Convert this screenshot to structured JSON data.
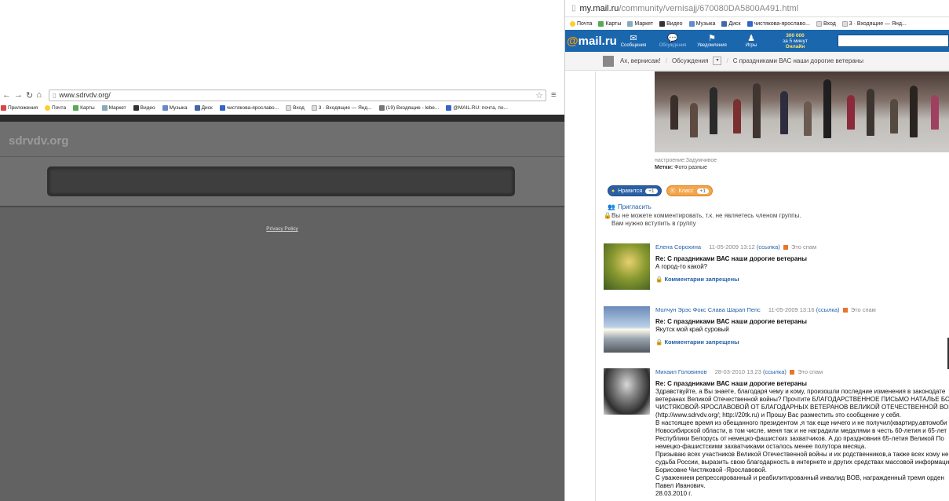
{
  "left": {
    "url": "www.sdrvdv.org/",
    "bookmarks": [
      "Приложения",
      "Почта",
      "Карты",
      "Маркет",
      "Видео",
      "Музыка",
      "Диск",
      "чистякова-ярославо...",
      "Вход",
      "3 · Входящие — Янд...",
      "(19) Входящие - lebe...",
      "@MAIL.RU: почта, по..."
    ],
    "site_name": "sdrvdv.org",
    "privacy_link": "Privacy Policy"
  },
  "right": {
    "url_domain": "my.mail.ru",
    "url_path": "/community/vernisajj/670080DA5800A491.html",
    "bookmarks": [
      "Почта",
      "Карты",
      "Маркет",
      "Видео",
      "Музыка",
      "Диск",
      "чистякова-ярославо...",
      "Вход",
      "3 · Входящие — Янд..."
    ],
    "header": {
      "logo_prefix": "@",
      "logo": "mail",
      "logo_suffix": ".ru",
      "items": [
        {
          "badge": "10",
          "label": "Сообщения"
        },
        {
          "badge": "",
          "label": "Обсуждения"
        },
        {
          "badge": "1",
          "label": "Уведомления"
        },
        {
          "badge": "1",
          "label": "Игры"
        }
      ],
      "promo_amount": "300 000",
      "promo_sub": "за 5 минут",
      "promo_online": "Онлайн"
    },
    "breadcrumbs": [
      "Ах, вернисаж!",
      "Обсуждения",
      "С праздниками ВАС наши дорогие ветераны"
    ],
    "post": {
      "mood_label": "настроение:",
      "mood": "Задумчивое",
      "tags_label": "Метки:",
      "tags": "Фото разные",
      "like_label": "Нравится",
      "like_count": "+1",
      "class_label": "Класс",
      "class_count": "+1",
      "invite": "Пригласить",
      "no_comment_1": "Вы не можете комментировать, т.к. не являетесь членом группы.",
      "no_comment_2": "Вам нужно вступить в группу"
    },
    "comments": [
      {
        "author": "Елена Сорохина",
        "date": "11-05-2009 13:12",
        "link": "(ссылка)",
        "spam": "Это спам",
        "title": "Re: С праздниками ВАС наши дорогие ветераны",
        "lines": [
          "А город-то какой?"
        ],
        "closed": "Комментарии запрещены"
      },
      {
        "author": "Молчун Эрэс Фокс Слава Шарап Пепс",
        "date": "11-05-2009 13:16",
        "link": "(ссылка)",
        "spam": "Это спам",
        "title": "Re: С праздниками ВАС наши дорогие ветераны",
        "lines": [
          "Якутск мой край суровый"
        ],
        "closed": "Комментарии запрещены"
      },
      {
        "author": "Михаил Головинов",
        "date": "28-03-2010 13:23",
        "link": "(ссылка)",
        "spam": "Это спам",
        "title": "Re: С праздниками ВАС наши дорогие ветераны",
        "lines": [
          "Здравствуйте, а Вы знаете, благодаря чему и кому, произошли последние изменения в законодате",
          "ветеранах Великой Отечественной войны? Прочтите БЛАГОДАРСТВЕННОЕ ПИСЬМО НАТАЛЬЕ БС",
          "ЧИСТЯКОВОЙ-ЯРОСЛАВОВОЙ ОТ БЛАГОДАРНЫХ ВЕТЕРАНОВ ВЕЛИКОЙ ОТЕЧЕСТВЕННОЙ ВОЙ",
          "(http://www.sdrvdv.org/; http://20tk.ru) и Прошу Вас разместить это сообщение у себя.",
          "В настоящее время из обещанного президентом ,я так еще ничего и не получил(квартиру,автомоби",
          "Новосибирской области, в том числе, меня так и не наградили медалями в честь 60-летия и 65-лет",
          "Республики Белорусь от немецко-фашистких захватчиков. А до праздновния 65-летия Великой По",
          "немецко-фашистскими захватчиками осталось менее полутора месяца.",
          "Призываю всех участников Великой Отечественной войны и их родственников,а также всех кому не",
          "судьба России, выразить свою благодарность в интернете и других средствах массовой информаци",
          "Борисовне Чистяковой -Ярославовой.",
          "С уважением репрессированный и реабилитированный инвалид ВОВ, награжденный тремя орден",
          "Павел Иванович.",
          "28.03.2010 г."
        ]
      }
    ]
  }
}
